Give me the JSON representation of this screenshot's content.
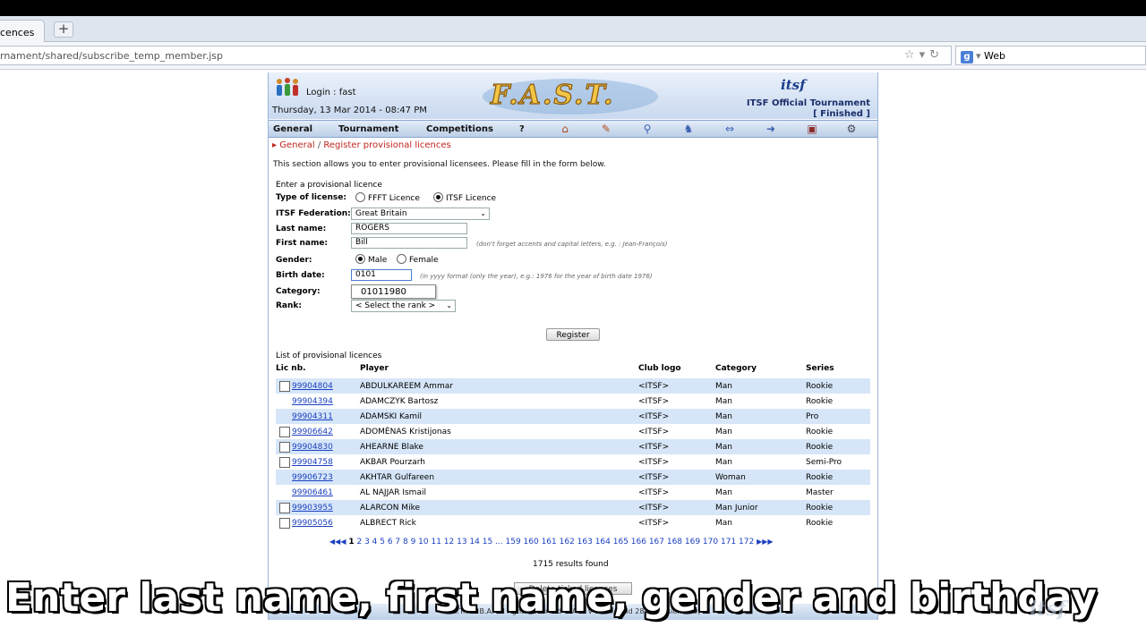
{
  "browser": {
    "tab_label": "cences",
    "new_tab_label": "+",
    "url": "rnament/shared/subscribe_temp_member.jsp",
    "search_engine_label": "Web"
  },
  "header": {
    "login": "Login : fast",
    "date": "Thursday, 13 Mar 2014 - 08:47 PM",
    "logo": "F.A.S.T.",
    "org_logo": "itsf",
    "tournament": "ITSF Official Tournament",
    "status": "[ Finished ]"
  },
  "nav": {
    "items": [
      "General",
      "Tournament",
      "Competitions",
      "?"
    ],
    "icons": [
      "home-icon",
      "pencil-icon",
      "search-icon",
      "players-icon",
      "teams-icon",
      "transfer-icon",
      "bus-icon",
      "settings-icon"
    ]
  },
  "breadcrumb": {
    "root": "General",
    "separator": "/",
    "current": "Register provisional licences"
  },
  "intro": "This section allows you to enter provisional licensees. Please fill in the form below.",
  "form": {
    "title": "Enter a provisional licence",
    "license_type_label": "Type of license:",
    "license_options": [
      "FFFT Licence",
      "ITSF Licence"
    ],
    "license_selected": "ITSF Licence",
    "federation_label": "ITSF Federation:",
    "federation_value": "Great Britain",
    "last_name_label": "Last name:",
    "last_name_value": "ROGERS",
    "first_name_label": "First name:",
    "first_name_value": "Bill",
    "first_name_hint": "(don't forget accents and capital letters, e.g. : Jean-François)",
    "gender_label": "Gender:",
    "gender_options": [
      "Male",
      "Female"
    ],
    "gender_selected": "Male",
    "birth_label": "Birth date:",
    "birth_value": "0101",
    "birth_hint": "(in yyyy format (only the year), e.g.: 1976 for the year of birth date 1976)",
    "autocomplete_suggestion": "01011980",
    "category_label": "Category:",
    "rank_label": "Rank:",
    "rank_value": "< Select the rank >",
    "register_button": "Register"
  },
  "list": {
    "title": "List of provisional licences",
    "headers": [
      "Lic nb.",
      "Player",
      "Club logo",
      "Category",
      "Series"
    ],
    "rows": [
      {
        "lic": "99904804",
        "player": "ABDULKAREEM Ammar",
        "club": "<ITSF>",
        "category": "Man",
        "series": "Rookie",
        "checkbox": true
      },
      {
        "lic": "99904394",
        "player": "ADAMCZYK Bartosz",
        "club": "<ITSF>",
        "category": "Man",
        "series": "Rookie",
        "checkbox": false
      },
      {
        "lic": "99904311",
        "player": "ADAMSKI Kamil",
        "club": "<ITSF>",
        "category": "Man",
        "series": "Pro",
        "checkbox": false
      },
      {
        "lic": "99906642",
        "player": "ADOMĖNAS Kristijonas",
        "club": "<ITSF>",
        "category": "Man",
        "series": "Rookie",
        "checkbox": true
      },
      {
        "lic": "99904830",
        "player": "AHEARNE Blake",
        "club": "<ITSF>",
        "category": "Man",
        "series": "Rookie",
        "checkbox": true
      },
      {
        "lic": "99904758",
        "player": "AKBAR Pourzarh",
        "club": "<ITSF>",
        "category": "Man",
        "series": "Semi-Pro",
        "checkbox": true
      },
      {
        "lic": "99906723",
        "player": "AKHTAR Gulfareen",
        "club": "<ITSF>",
        "category": "Woman",
        "series": "Rookie",
        "checkbox": false
      },
      {
        "lic": "99906461",
        "player": "AL NAJJAR Ismail",
        "club": "<ITSF>",
        "category": "Man",
        "series": "Master",
        "checkbox": false
      },
      {
        "lic": "99903955",
        "player": "ALARCON Mike",
        "club": "<ITSF>",
        "category": "Man Junior",
        "series": "Rookie",
        "checkbox": true
      },
      {
        "lic": "99905056",
        "player": "ALBRECT Rick",
        "club": "<ITSF>",
        "category": "Man",
        "series": "Rookie",
        "checkbox": true
      }
    ],
    "pager_first": "◀◀",
    "pager_prev": "◀",
    "pager_current": "1",
    "pager_pages": "2 3 4 5 6 7 8 9 10 11 12 13 14 15 ... 159 160 161 162 163 164 165 166 167 168 169 170 171 172",
    "pager_next": "▶",
    "pager_last": "▶▶",
    "results": "1715 results found",
    "delete_button": "Delete ticked licences"
  },
  "footer": "© I.T.S.F. B.A. All rights reserved - FAST v 1.4.4 build 283 (revision 439)",
  "caption": "Enter last name, first name, gender and birthday",
  "watermark": "itsf"
}
